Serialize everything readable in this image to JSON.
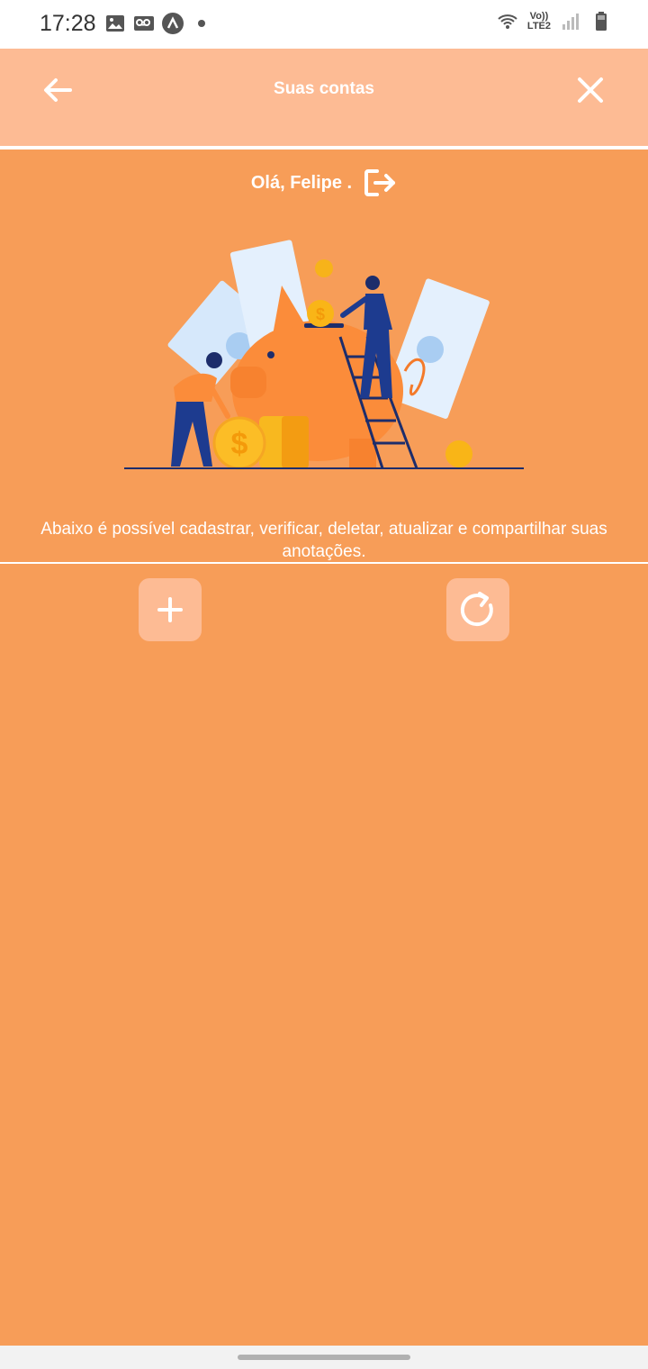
{
  "status_bar": {
    "time": "17:28",
    "network_label_top": "Vo))",
    "network_label_bottom": "LTE2"
  },
  "header": {
    "title": "Suas contas",
    "back_icon": "arrow-left-icon",
    "close_icon": "close-icon"
  },
  "greeting": {
    "text": "Olá, Felipe .",
    "logout_icon": "logout-icon"
  },
  "info": {
    "text": "Abaixo é possível cadastrar, verificar, deletar, atualizar e compartilhar suas anotações."
  },
  "actions": {
    "add_icon": "plus-icon",
    "refresh_icon": "refresh-icon"
  },
  "colors": {
    "background": "#f79d58",
    "header": "#fdbb94",
    "button": "#fdbb94"
  }
}
